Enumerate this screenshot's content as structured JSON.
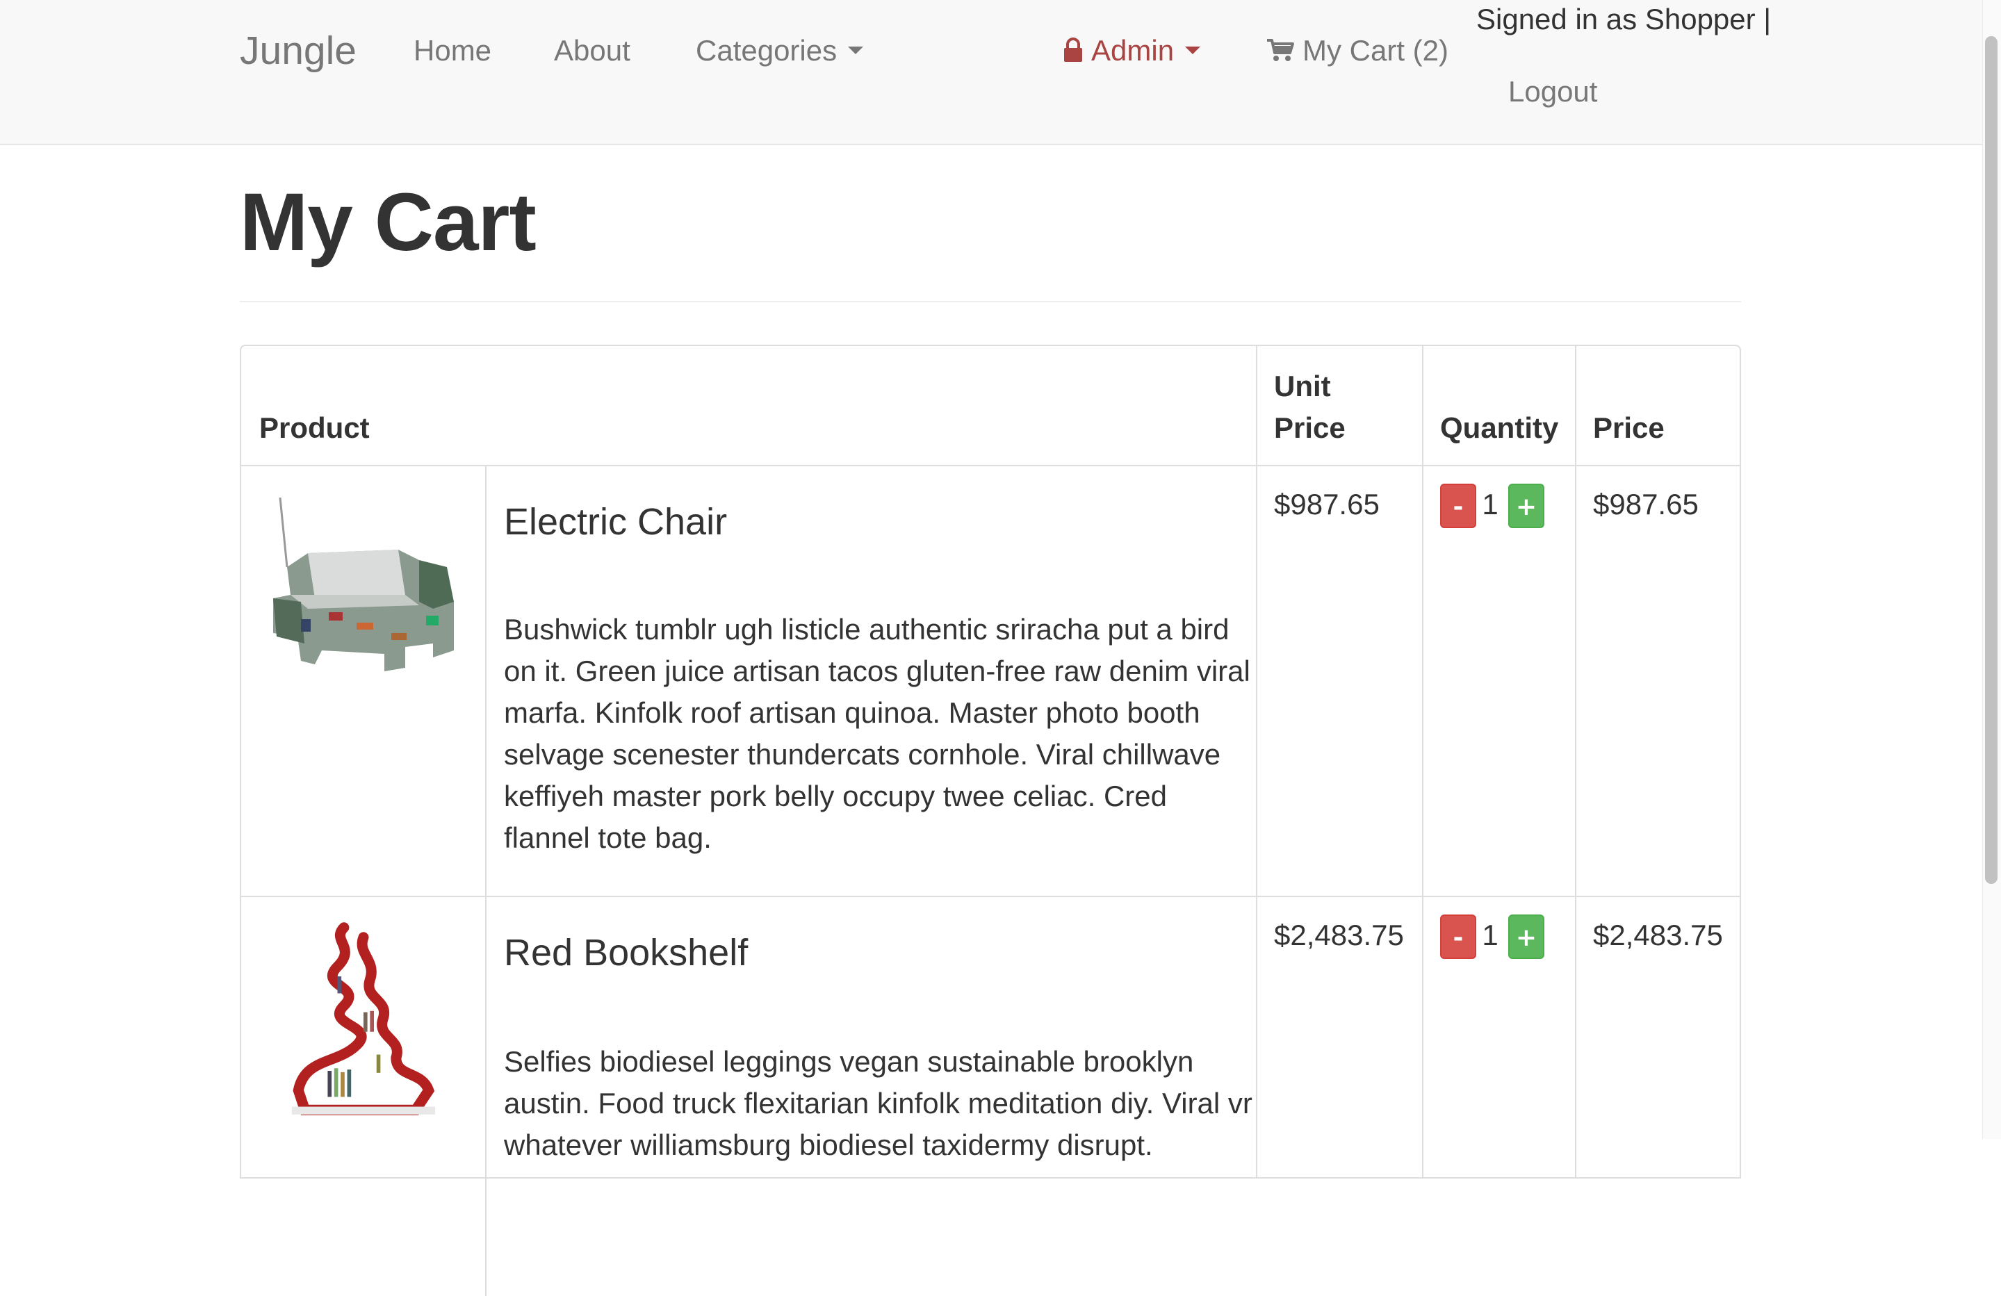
{
  "navbar": {
    "brand": "Jungle",
    "links": {
      "home": "Home",
      "about": "About",
      "categories": "Categories",
      "admin": "Admin",
      "cart": "My Cart (2)"
    },
    "signed_in_text": "Signed in as Shopper |",
    "logout": "Logout",
    "admin_color": "#a94442"
  },
  "page": {
    "title": "My Cart"
  },
  "table": {
    "headers": {
      "product": "Product",
      "unit_price_line1": "Unit",
      "unit_price_line2": "Price",
      "quantity": "Quantity",
      "price": "Price"
    },
    "rows": [
      {
        "name": "Electric Chair",
        "image_icon": "chair-image",
        "description": "Bushwick tumblr ugh listicle authentic sriracha put a bird on it. Green juice artisan tacos gluten-free raw denim viral marfa. Kinfolk roof artisan quinoa. Master photo booth selvage scenester thundercats cornhole. Viral chillwave keffiyeh master pork belly occupy twee celiac. Cred flannel tote bag.",
        "unit_price": "$987.65",
        "quantity": "1",
        "price": "$987.65",
        "minus_label": "-",
        "plus_label": "+"
      },
      {
        "name": "Red Bookshelf",
        "image_icon": "bookshelf-image",
        "description": "Selfies biodiesel leggings vegan sustainable brooklyn austin. Food truck flexitarian kinfolk meditation diy. Viral vr whatever williamsburg biodiesel taxidermy disrupt.",
        "unit_price": "$2,483.75",
        "quantity": "1",
        "price": "$2,483.75",
        "minus_label": "-",
        "plus_label": "+"
      }
    ]
  },
  "colors": {
    "danger": "#d9534f",
    "success": "#5cb85c",
    "navbar_bg": "#f8f8f8"
  }
}
